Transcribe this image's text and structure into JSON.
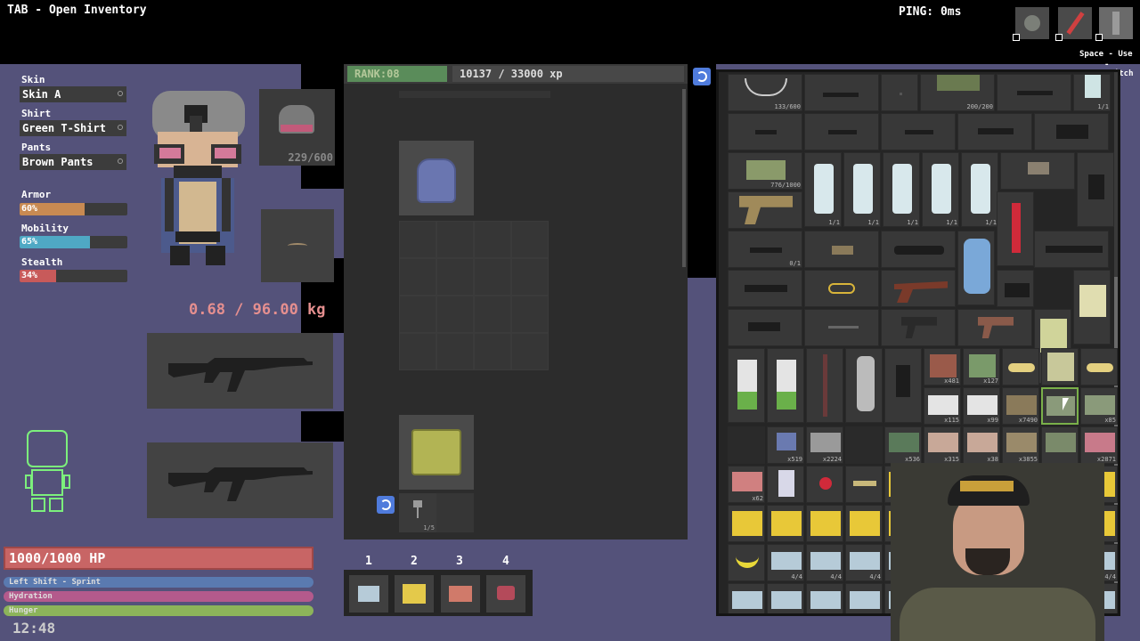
{
  "hud": {
    "inventory_hint": "TAB - Open Inventory",
    "ping": "PING: 0ms",
    "space_hint": "Space - Use",
    "switch_hint": "- Switch",
    "clock": "12:48"
  },
  "customization": {
    "skin_label": "Skin",
    "skin_value": "Skin A",
    "shirt_label": "Shirt",
    "shirt_value": "Green T-Shirt",
    "pants_label": "Pants",
    "pants_value": "Brown Pants"
  },
  "stats": [
    {
      "label": "Armor",
      "value": "60%",
      "fraction": 0.6,
      "color": "#c88a52"
    },
    {
      "label": "Mobility",
      "value": "65%",
      "fraction": 0.65,
      "color": "#4fa8c4"
    },
    {
      "label": "Stealth",
      "value": "34%",
      "fraction": 0.34,
      "color": "#c85a5a"
    }
  ],
  "helmet_durability": "229/600",
  "weight": "0.68 / 96.00 kg",
  "rank": {
    "label": "RANK:08",
    "xp": "10137 / 33000 xp",
    "fraction": 0.31
  },
  "vitals": {
    "hp": "1000/1000 HP",
    "sprint": "Left Shift - Sprint",
    "hydration": "Hydration",
    "hunger": "Hunger"
  },
  "pouch_count": "1/5",
  "hotbar": {
    "numbers": [
      "1",
      "2",
      "3",
      "4"
    ]
  },
  "inventory_counts": {
    "rope": "133/600",
    "ammo_top": "200/200",
    "ammo_box": "776/1000",
    "c1": "1/1",
    "c2": "0/1",
    "r1": "x481",
    "r2": "x127",
    "r3": "x115",
    "r4": "x99",
    "r5": "x7490",
    "r6": "x85",
    "r7": "x519",
    "r8": "x2224",
    "r9": "x536",
    "r10": "x315",
    "r11": "x38",
    "r12": "x3855",
    "r13": "x2871",
    "r14": "x62",
    "r15": "4/4"
  },
  "colors": {
    "background": "#54527a",
    "hp_bar": "#c86565",
    "sprint_bar": "#5a7ab0",
    "hydration_bar": "#b45a8c",
    "hunger_bar": "#8cb45a",
    "rank_bar": "#5a8c5a"
  }
}
